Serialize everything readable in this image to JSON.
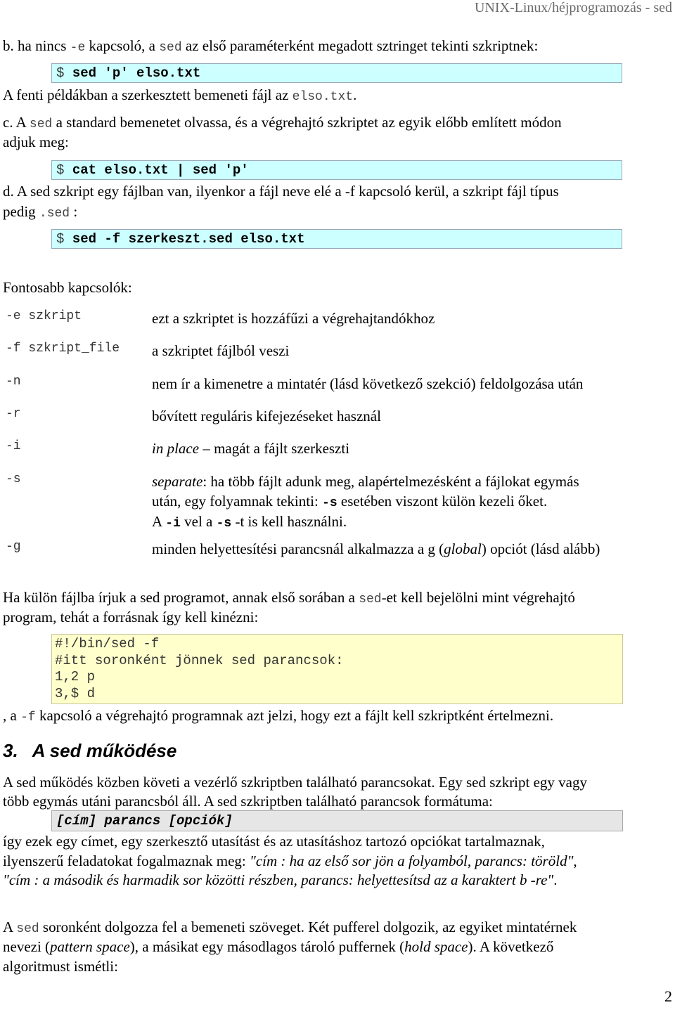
{
  "header": {
    "title": "UNIX-Linux/héjprogramozás - sed"
  },
  "item_b": {
    "prefix": "b. ha nincs ",
    "flag": "-e",
    "mid": "  kapcsoló, a ",
    "cmd": "sed",
    "suffix": " az első paraméterként megadott sztringet tekinti szkriptnek:",
    "box_prompt": "$ ",
    "box_cmd": "sed 'p' elso.txt",
    "after_prefix": "A fenti példákban a szerkesztett bemeneti fájl az ",
    "after_file": "elso.txt",
    "after_suffix": "."
  },
  "item_c": {
    "prefix": "c.  A ",
    "cmd": "sed",
    "line1": " a standard bemenetet olvassa, és a végrehajtó szkriptet az egyik előbb említett módon",
    "line2": "adjuk meg:",
    "box_prompt": "$ ",
    "box_cmd": "cat elso.txt | sed 'p'"
  },
  "item_d": {
    "line1": "d. A sed szkript egy fájlban van, ilyenkor a fájl neve elé a -f kapcsoló kerül, a szkript fájl típus",
    "line2_prefix": "pedig ",
    "line2_ext": ".sed",
    "line2_suffix": " :",
    "box_prompt": "$ ",
    "box_cmd": "sed -f szerkeszt.sed elso.txt"
  },
  "options": {
    "title": "Fontosabb kapcsolók:",
    "items": [
      {
        "key": "-e szkript",
        "desc": "ezt a szkriptet is hozzáfűzi a végrehajtandókhoz"
      },
      {
        "key": "-f szkript_file",
        "desc": "a szkriptet fájlból veszi"
      },
      {
        "key": "-n",
        "desc": "nem ír a kimenetre a mintatér (lásd következő szekció) feldolgozása után"
      },
      {
        "key": "-r",
        "desc": "bővített reguláris kifejezéseket használ"
      },
      {
        "key": "-i",
        "desc_italic": "in place",
        "desc": " – magát a fájlt szerkeszti"
      },
      {
        "key": "-s",
        "desc_italic": "separate",
        "desc_line1": ": ha több fájlt adunk meg, alapértelmezésként a fájlokat egymás",
        "desc_line2_prefix": "után, egy folyamnak tekinti: ",
        "desc_line2_flag": "-s",
        "desc_line2_suffix": "  esetében viszont külön kezeli őket.",
        "desc_line3_prefix": "A ",
        "desc_line3_flag1": "-i",
        "desc_line3_mid": "  vel a ",
        "desc_line3_flag2": "-s",
        "desc_line3_suffix": " -t is kell használni."
      },
      {
        "key": "-g",
        "desc_prefix": "minden helyettesítési parancsnál alkalmazza a g (",
        "desc_italic": "global",
        "desc_suffix": ") opciót (lásd alább)"
      }
    ]
  },
  "shebang_section": {
    "line1_prefix": "Ha külön fájlba írjuk a sed programot, annak első sorában a ",
    "line1_cmd": "sed",
    "line1_suffix": "-et kell bejelölni mint végrehajtó",
    "line2": "program, tehát a forrásnak így kell kinézni:",
    "script_lines": [
      "#!/bin/sed -f",
      "#itt soronként jönnek sed parancsok:",
      "1,2 p",
      "3,$ d"
    ],
    "after_prefix": ", a ",
    "after_flag": "-f",
    "after_suffix": " kapcsoló a végrehajtó programnak azt jelzi, hogy ezt a fájlt kell szkriptként értelmezni."
  },
  "section3": {
    "number": "3.",
    "title": "A sed működése",
    "para1_line1": "A sed működés közben követi a vezérlő szkriptben található parancsokat. Egy sed szkript egy vagy",
    "para1_line2": "több egymás utáni parancsból áll.  A sed szkriptben található parancsok formátuma:",
    "format": "[cím] parancs [opciók]",
    "para2_line1": "így ezek egy címet, egy szerkesztő utasítást és az utasításhoz tartozó opciókat tartalmaznak,",
    "para2_line2_prefix": "ilyenszerű feladatokat fogalmaznak meg: ",
    "para2_line2_italic": "\"cím : ha az első sor jön a folyamból,  parancs: töröld\"",
    "para2_line2_suffix": ",",
    "para2_line3_italic": "\"cím : a második és harmadik sor közötti részben, parancs: helyettesítsd az a karaktert b -re\"",
    "para2_line3_suffix": ".",
    "para3_line1_prefix": "A ",
    "para3_line1_cmd": "sed",
    "para3_line1_suffix": " soronként dolgozza fel a bemeneti szöveget. Két pufferel dolgozik, az egyiket mintatérnek",
    "para3_line2_a": "nevezi (",
    "para3_line2_i1": "pattern space",
    "para3_line2_b": "), a másikat egy másodlagos tároló puffernek (",
    "para3_line2_i2": "hold space",
    "para3_line2_c": "). A következő",
    "para3_line3": "algoritmust ismétli:"
  },
  "footer": {
    "page_number": "2"
  }
}
